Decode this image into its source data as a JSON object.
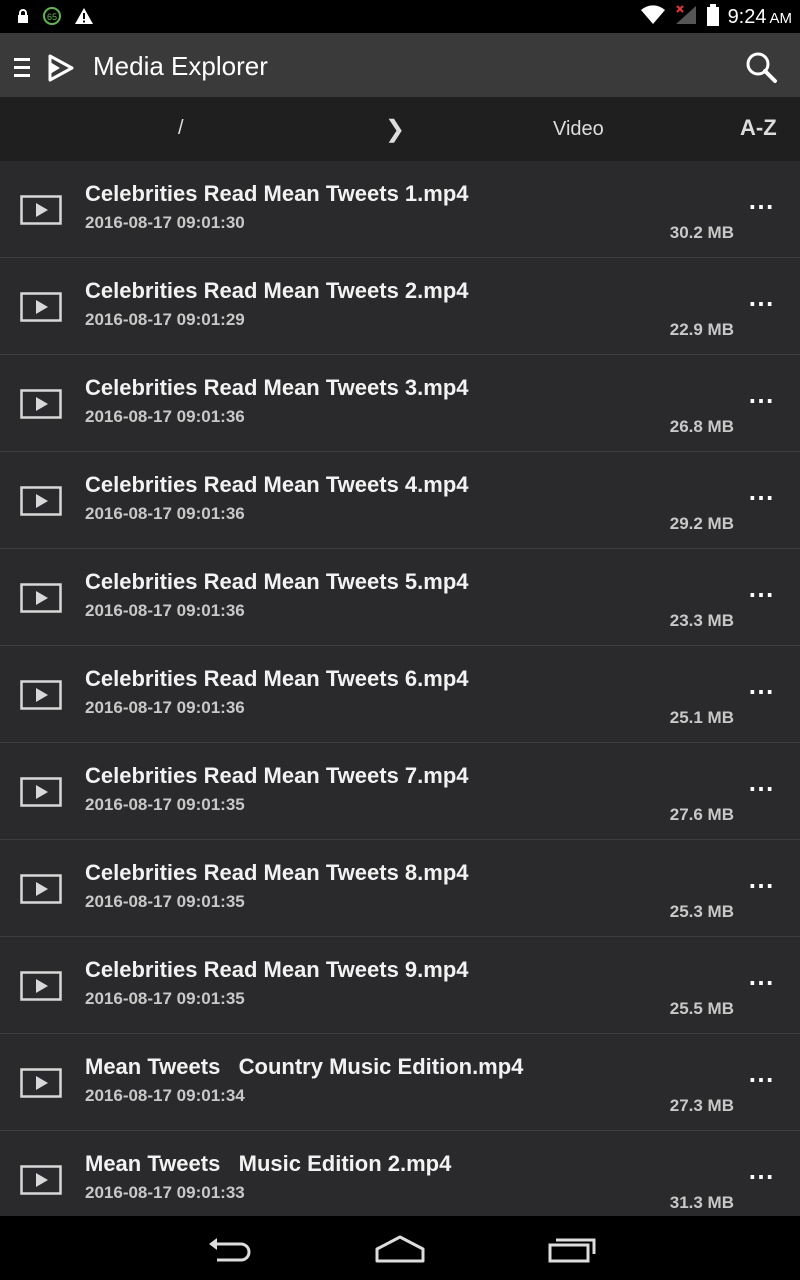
{
  "status_bar": {
    "time": "9:24",
    "ampm": "AM",
    "badge": "65",
    "icons": [
      "lock-icon",
      "badge-icon",
      "warning-icon",
      "wifi-icon",
      "signal-icon",
      "battery-icon"
    ]
  },
  "app_bar": {
    "title": "Media Explorer",
    "icons": [
      "menu-icon",
      "app-logo-icon",
      "search-icon"
    ]
  },
  "path_bar": {
    "root": "/",
    "separator": "❯",
    "current": "Video",
    "sort": "A-Z"
  },
  "files": [
    {
      "name": "Celebrities Read Mean Tweets 1.mp4",
      "date": "2016-08-17 09:01:30",
      "size": "30.2 MB"
    },
    {
      "name": "Celebrities Read Mean Tweets 2.mp4",
      "date": "2016-08-17 09:01:29",
      "size": "22.9 MB"
    },
    {
      "name": "Celebrities Read Mean Tweets 3.mp4",
      "date": "2016-08-17 09:01:36",
      "size": "26.8 MB"
    },
    {
      "name": "Celebrities Read Mean Tweets 4.mp4",
      "date": "2016-08-17 09:01:36",
      "size": "29.2 MB"
    },
    {
      "name": "Celebrities Read Mean Tweets 5.mp4",
      "date": "2016-08-17 09:01:36",
      "size": "23.3 MB"
    },
    {
      "name": "Celebrities Read Mean Tweets 6.mp4",
      "date": "2016-08-17 09:01:36",
      "size": "25.1 MB"
    },
    {
      "name": "Celebrities Read Mean Tweets 7.mp4",
      "date": "2016-08-17 09:01:35",
      "size": "27.6 MB"
    },
    {
      "name": "Celebrities Read Mean Tweets 8.mp4",
      "date": "2016-08-17 09:01:35",
      "size": "25.3 MB"
    },
    {
      "name": "Celebrities Read Mean Tweets 9.mp4",
      "date": "2016-08-17 09:01:35",
      "size": "25.5 MB"
    },
    {
      "name": "Mean Tweets   Country Music Edition.mp4",
      "date": "2016-08-17 09:01:34",
      "size": "27.3 MB"
    },
    {
      "name": "Mean Tweets   Music Edition 2.mp4",
      "date": "2016-08-17 09:01:33",
      "size": "31.3 MB"
    }
  ],
  "more_label": "⋯",
  "nav_bar": {
    "icons": [
      "back-icon",
      "home-icon",
      "recents-icon"
    ]
  }
}
